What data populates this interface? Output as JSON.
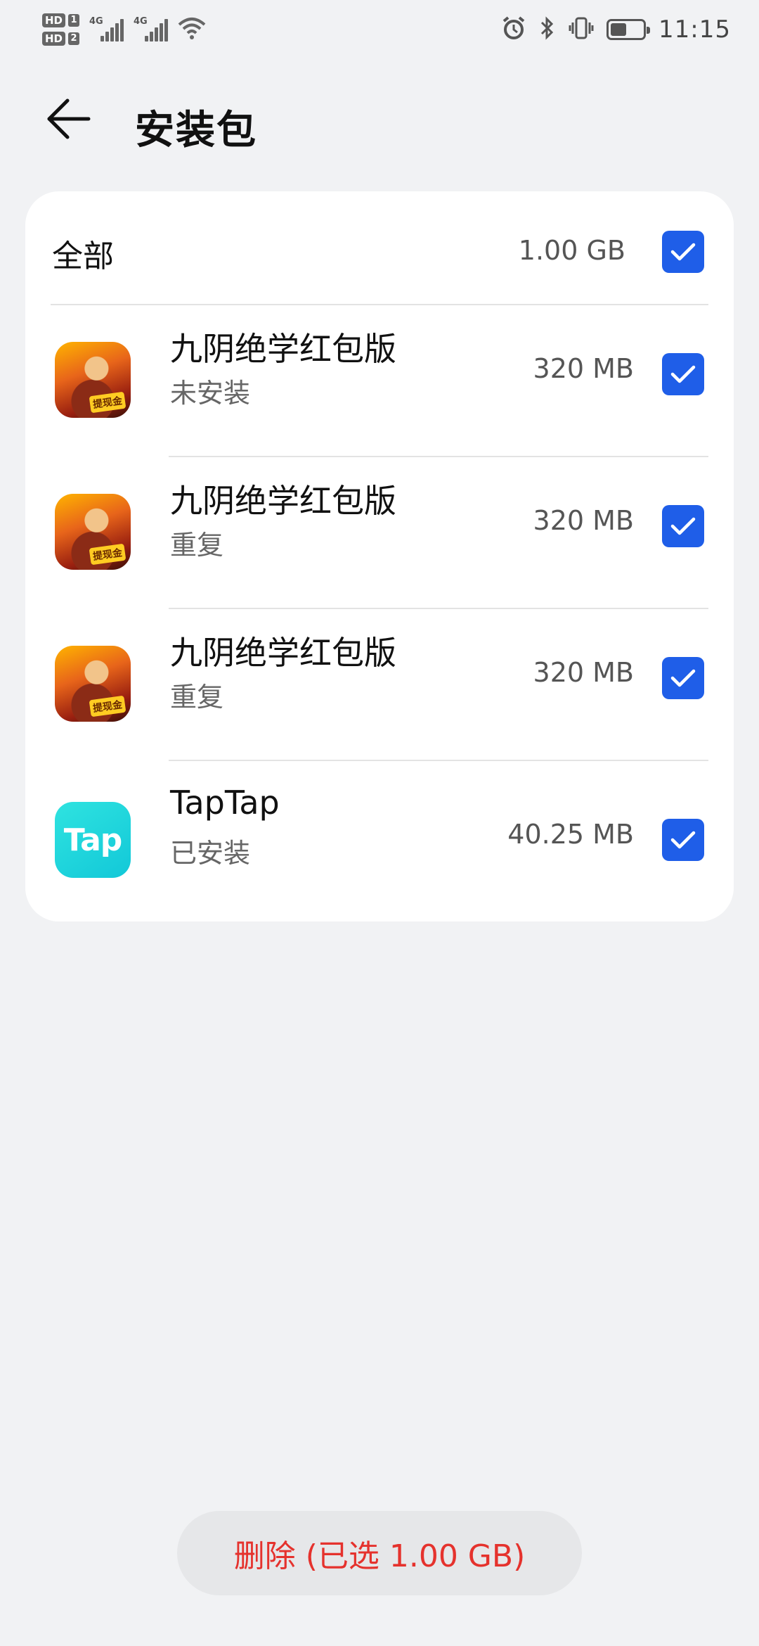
{
  "status_bar": {
    "sim1": "HD",
    "sim1_num": "1",
    "sim2": "HD",
    "sim2_num": "2",
    "network1": "4G",
    "network2": "4G",
    "time": "11:15",
    "battery_level": 0.5,
    "icons": [
      "alarm-icon",
      "bluetooth-icon",
      "vibrate-icon",
      "battery-icon",
      "wifi-icon"
    ]
  },
  "header": {
    "back_icon": "arrow-left-icon",
    "title": "安装包"
  },
  "select_all": {
    "label": "全部",
    "size": "1.00 GB",
    "checked": true
  },
  "items": [
    {
      "name": "九阴绝学红包版",
      "status": "未安装",
      "size": "320 MB",
      "icon": "game-icon",
      "checked": true
    },
    {
      "name": "九阴绝学红包版",
      "status": "重复",
      "size": "320 MB",
      "icon": "game-icon",
      "checked": true
    },
    {
      "name": "九阴绝学红包版",
      "status": "重复",
      "size": "320 MB",
      "icon": "game-icon",
      "checked": true
    },
    {
      "name": "TapTap",
      "status": "已安装",
      "size": "40.25 MB",
      "icon": "taptap-icon",
      "icon_text": "Tap",
      "checked": true
    }
  ],
  "icon_badge": "提现金",
  "delete_button": "删除 (已选 1.00 GB)",
  "colors": {
    "accent": "#1f5ee8",
    "delete": "#e5322d",
    "background": "#f1f2f4"
  }
}
